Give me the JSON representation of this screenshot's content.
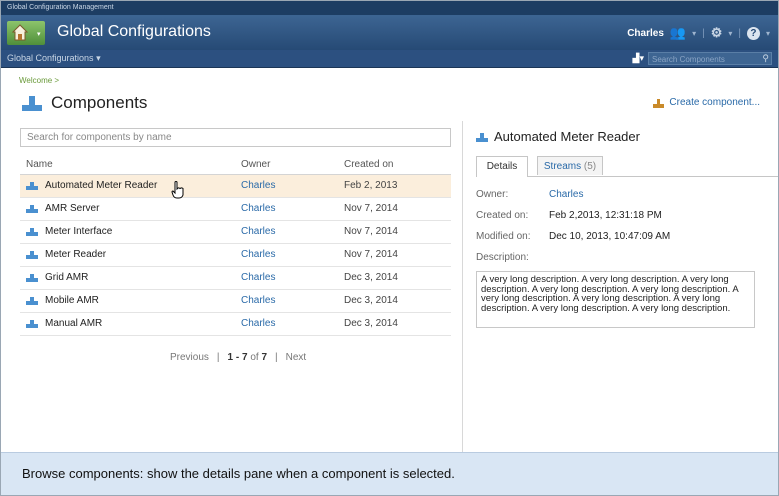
{
  "app": {
    "suite_name": "Global Configuration Management",
    "title": "Global Configurations"
  },
  "header": {
    "user": "Charles"
  },
  "nav": {
    "menu_label": "Global Configurations",
    "search_placeholder": "Search Components"
  },
  "breadcrumb": "Welcome >",
  "page": {
    "title": "Components",
    "create_label": "Create component..."
  },
  "search": {
    "placeholder": "Search for components by name"
  },
  "table": {
    "headers": {
      "name": "Name",
      "owner": "Owner",
      "created": "Created on"
    },
    "rows": [
      {
        "name": "Automated Meter Reader",
        "owner": "Charles",
        "created": "Feb 2, 2013"
      },
      {
        "name": "AMR Server",
        "owner": "Charles",
        "created": "Nov 7, 2014"
      },
      {
        "name": "Meter Interface",
        "owner": "Charles",
        "created": "Nov 7, 2014"
      },
      {
        "name": "Meter Reader",
        "owner": "Charles",
        "created": "Nov 7, 2014"
      },
      {
        "name": "Grid AMR",
        "owner": "Charles",
        "created": "Dec 3, 2014"
      },
      {
        "name": "Mobile AMR",
        "owner": "Charles",
        "created": "Dec 3, 2014"
      },
      {
        "name": "Manual AMR",
        "owner": "Charles",
        "created": "Dec 3, 2014"
      }
    ],
    "selected_index": 0
  },
  "pager": {
    "previous": "Previous",
    "sep": "|",
    "range": "1 - 7",
    "of": "of",
    "total": "7",
    "next": "Next"
  },
  "details": {
    "title": "Automated Meter Reader",
    "tabs": {
      "details": "Details",
      "streams": "Streams",
      "streams_count": "(5)"
    },
    "owner_label": "Owner:",
    "owner": "Charles",
    "created_label": "Created on:",
    "created": "Feb 2,2013, 12:31:18 PM",
    "modified_label": "Modified on:",
    "modified": "Dec 10, 2013, 10:47:09 AM",
    "description_label": "Description:",
    "description": "A very long description. A very long description. A very long description. A very long description. A very long description. A very long description. A very long description. A very long description. A very long description. A very long description."
  },
  "footer": {
    "caption": "Browse components: show the details pane when a component is selected."
  },
  "colors": {
    "header_dark": "#264a75",
    "link": "#2a6aa8",
    "selected_row": "#fbeedc",
    "breadcrumb": "#6a9a3a",
    "footer": "#d9e6f4"
  }
}
